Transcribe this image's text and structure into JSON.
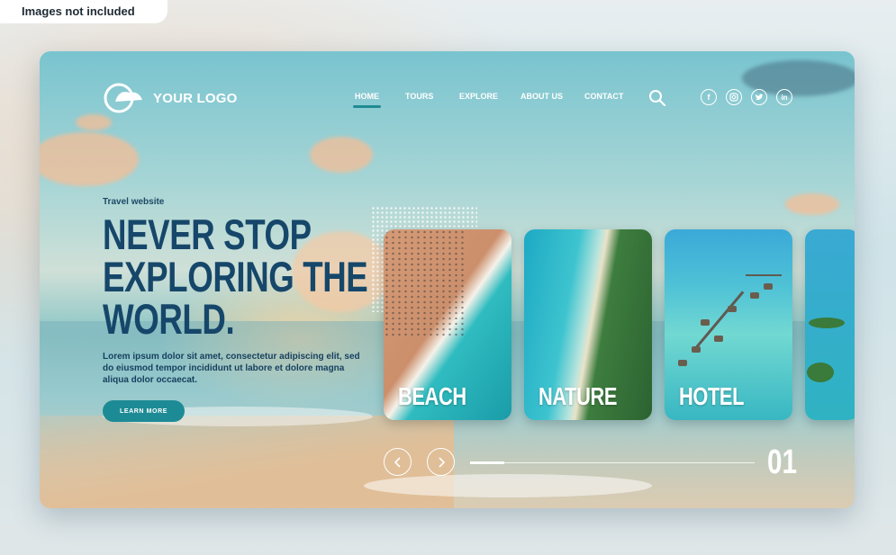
{
  "badge": "Images not included",
  "logo": {
    "text": "YOUR LOGO"
  },
  "nav": {
    "items": [
      {
        "label": "HOME",
        "active": true
      },
      {
        "label": "TOURS",
        "active": false
      },
      {
        "label": "EXPLORE",
        "active": false
      },
      {
        "label": "ABOUT US",
        "active": false
      },
      {
        "label": "CONTACT",
        "active": false
      }
    ]
  },
  "icons": {
    "search": "search-icon",
    "social": [
      "facebook-icon",
      "instagram-icon",
      "twitter-icon",
      "linkedin-icon"
    ]
  },
  "hero": {
    "tagline": "Travel website",
    "headline": [
      "NEVER STOP",
      "EXPLORING THE",
      "WORLD."
    ],
    "body": "Lorem ipsum dolor sit amet, consectetur adipiscing elit, sed do eiusmod tempor incididunt ut labore et dolore magna aliqua dolor occaecat.",
    "cta": "LEARN MORE"
  },
  "cards": [
    {
      "label": "BEACH"
    },
    {
      "label": "NATURE"
    },
    {
      "label": "HOTEL"
    },
    {
      "label": ""
    }
  ],
  "carousel": {
    "counter": "01",
    "progress": 0.12
  },
  "colors": {
    "accent": "#1d8b95",
    "headline": "#16476a"
  }
}
